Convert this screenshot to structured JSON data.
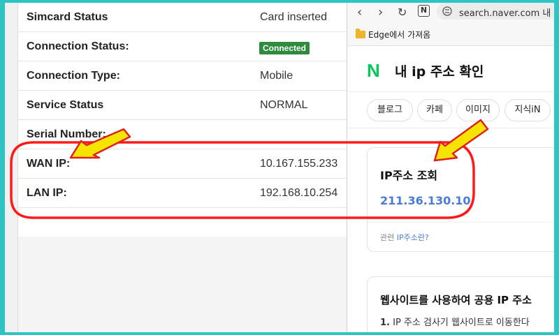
{
  "router": {
    "rows": [
      {
        "label": "Simcard Status",
        "value": "Card inserted"
      },
      {
        "label": "Connection Status:",
        "badge": "Connected"
      },
      {
        "label": "Connection Type:",
        "value": "Mobile"
      },
      {
        "label": "Service Status",
        "value": "NORMAL"
      },
      {
        "label": "Serial Number:",
        "value": ""
      },
      {
        "label": "WAN IP:",
        "value": "10.167.155.233"
      },
      {
        "label": "LAN IP:",
        "value": "192.168.10.254"
      }
    ]
  },
  "browser": {
    "nav": {
      "back": "‹",
      "forward": "›",
      "reload": "↻",
      "n_icon": "N"
    },
    "url": "search.naver.com",
    "url_suffix": "내",
    "bookmark": "Edge에서 가져옴",
    "logo": "N",
    "query": "내 ip 주소 확인",
    "chips": [
      "블로그",
      "카페",
      "이미지",
      "지식iN"
    ],
    "card": {
      "title": "IP주소 조회",
      "ip": "211.36.130.10",
      "related_prefix": "관련",
      "related_link": "IP주소란?"
    },
    "card2": {
      "heading": "웹사이트를 사용하여 공용 IP 주소",
      "step_num": "1.",
      "step_text": "IP 주소 검사기 웹사이트로 이동한다"
    }
  },
  "colors": {
    "background": "#2ec4c4",
    "highlight": "#ff1a1a",
    "arrow_fill": "#f5e400",
    "badge": "#2e8b3e",
    "naver_green": "#03c75a",
    "ip_blue": "#4a7bd8"
  }
}
